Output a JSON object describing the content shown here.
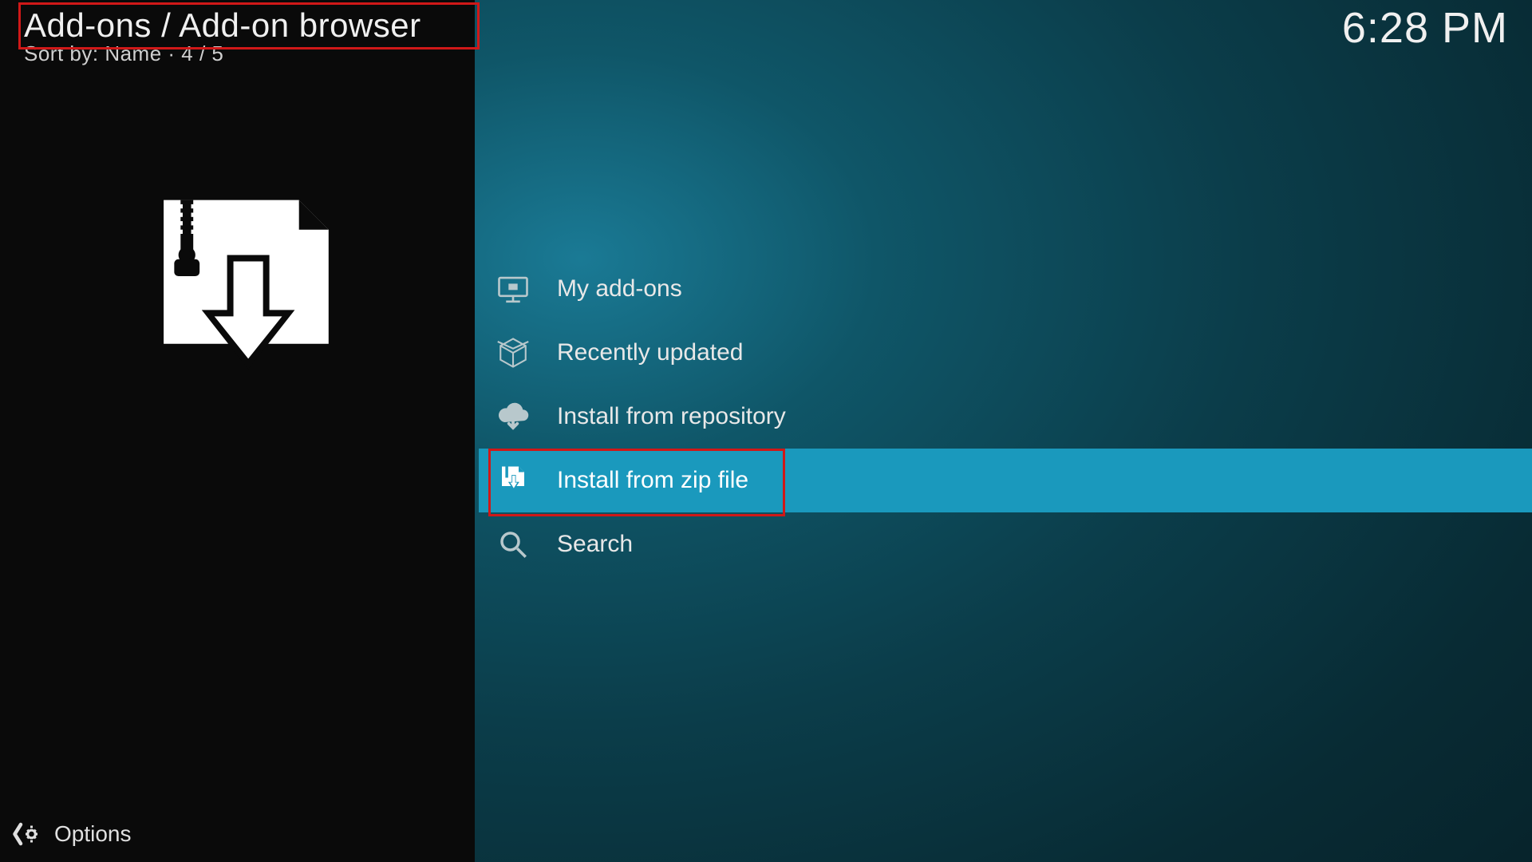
{
  "header": {
    "breadcrumb": "Add-ons / Add-on browser",
    "sort_info": "Sort by: Name  ·  4 / 5",
    "clock": "6:28 PM"
  },
  "menu": {
    "items": [
      {
        "icon": "monitor-icon",
        "label": "My add-ons"
      },
      {
        "icon": "open-box-icon",
        "label": "Recently updated"
      },
      {
        "icon": "cloud-download-icon",
        "label": "Install from repository"
      },
      {
        "icon": "zip-download-icon",
        "label": "Install from zip file"
      },
      {
        "icon": "magnify-icon",
        "label": "Search"
      }
    ]
  },
  "footer": {
    "options_label": "Options"
  }
}
